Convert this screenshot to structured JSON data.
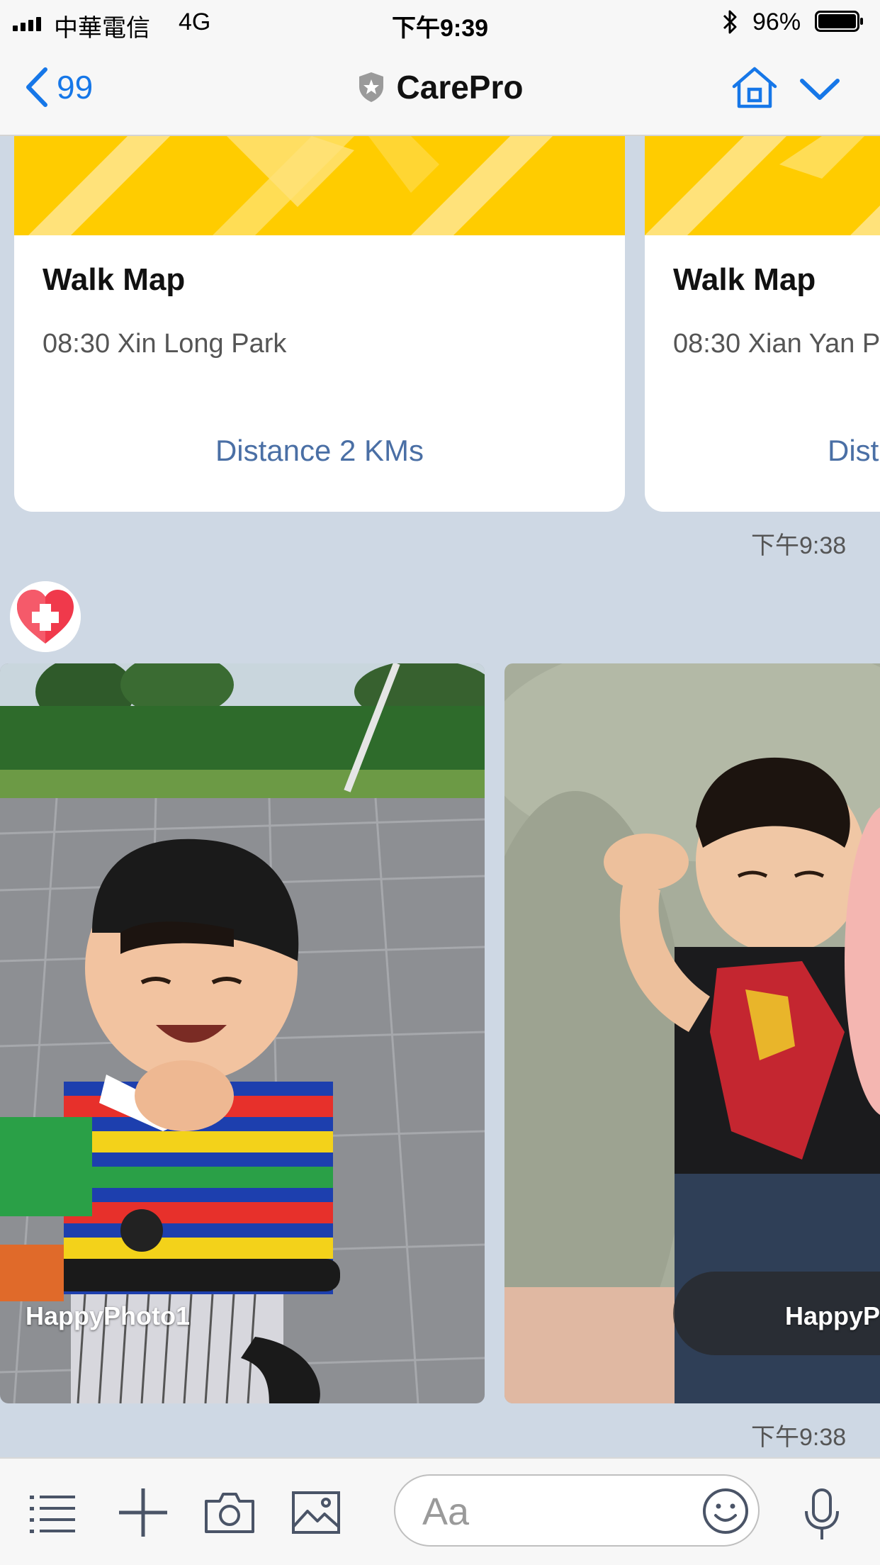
{
  "status_bar": {
    "carrier": "中華電信",
    "network": "4G",
    "time": "下午9:39",
    "battery": "96%"
  },
  "nav": {
    "back_count": "99",
    "title": "CarePro"
  },
  "walk_cards": [
    {
      "title": "Walk Map",
      "subtitle": "08:30 Xin Long Park",
      "link": "Distance 2 KMs"
    },
    {
      "title": "Walk Map",
      "subtitle": "08:30 Xian Yan P",
      "link": "Dist"
    }
  ],
  "timestamps": [
    "下午9:38",
    "下午9:38"
  ],
  "photos": [
    {
      "label": "HappyPhoto1"
    },
    {
      "label": "HappyP"
    }
  ],
  "composer": {
    "placeholder": "Aa"
  },
  "colors": {
    "accent": "#1677e8",
    "chat_background": "#ced8e4",
    "banner_yellow": "#ffcc00",
    "link_blue": "#4a6fa5"
  }
}
